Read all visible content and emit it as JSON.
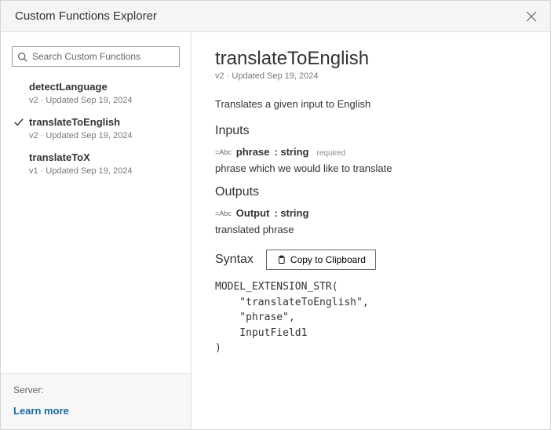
{
  "header": {
    "title": "Custom Functions Explorer"
  },
  "search": {
    "placeholder": "Search Custom Functions"
  },
  "functions": [
    {
      "name": "detectLanguage",
      "meta": "v2 · Updated Sep 19, 2024",
      "selected": false
    },
    {
      "name": "translateToEnglish",
      "meta": "v2 · Updated Sep 19, 2024",
      "selected": true
    },
    {
      "name": "translateToX",
      "meta": "v1 · Updated Sep 19, 2024",
      "selected": false
    }
  ],
  "sidebarFooter": {
    "serverLabel": "Server:",
    "learnMore": "Learn more"
  },
  "detail": {
    "title": "translateToEnglish",
    "meta": "v2 · Updated Sep 19, 2024",
    "description": "Translates a given input to English",
    "inputsHeading": "Inputs",
    "input": {
      "name": "phrase",
      "type": "string",
      "required": "required",
      "desc": "phrase which we would like to translate"
    },
    "outputsHeading": "Outputs",
    "output": {
      "name": "Output",
      "type": "string",
      "desc": "translated phrase"
    },
    "syntaxHeading": "Syntax",
    "copyLabel": "Copy to Clipboard",
    "code": "MODEL_EXTENSION_STR(\n    \"translateToEnglish\",\n    \"phrase\",\n    InputField1\n)"
  }
}
